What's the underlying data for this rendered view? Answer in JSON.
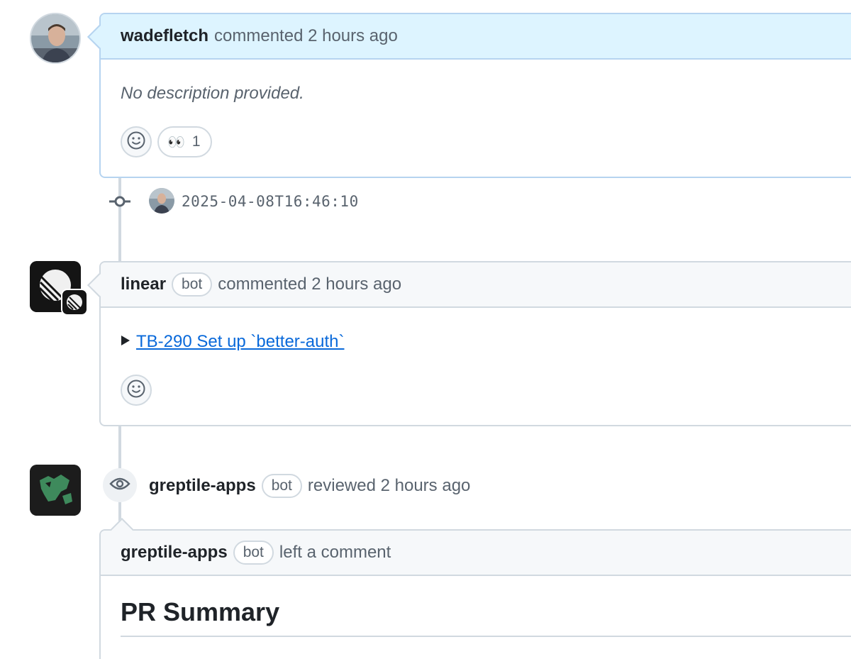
{
  "comments": [
    {
      "author": "wadefletch",
      "action": "commented 2 hours ago",
      "body": "No description provided.",
      "reactions": [
        {
          "emoji": "👀",
          "count": "1"
        }
      ]
    },
    {
      "author": "linear",
      "badge": "bot",
      "action": "commented 2 hours ago",
      "link_text": "TB-290 Set up `better-auth`"
    }
  ],
  "commit": {
    "timestamp": "2025-04-08T16:46:10"
  },
  "review": {
    "author": "greptile-apps",
    "badge": "bot",
    "action": "reviewed 2 hours ago",
    "comment_author": "greptile-apps",
    "comment_badge": "bot",
    "comment_action": "left a comment",
    "heading": "PR Summary"
  },
  "colors": {
    "highlight_header": "#ddf4ff",
    "link": "#0969da",
    "border": "#d1d9e0"
  },
  "icons": [
    "smiley-icon",
    "commit-icon",
    "eye-icon",
    "linear-logo-icon",
    "greptile-logo-icon",
    "triangle-right-icon"
  ]
}
